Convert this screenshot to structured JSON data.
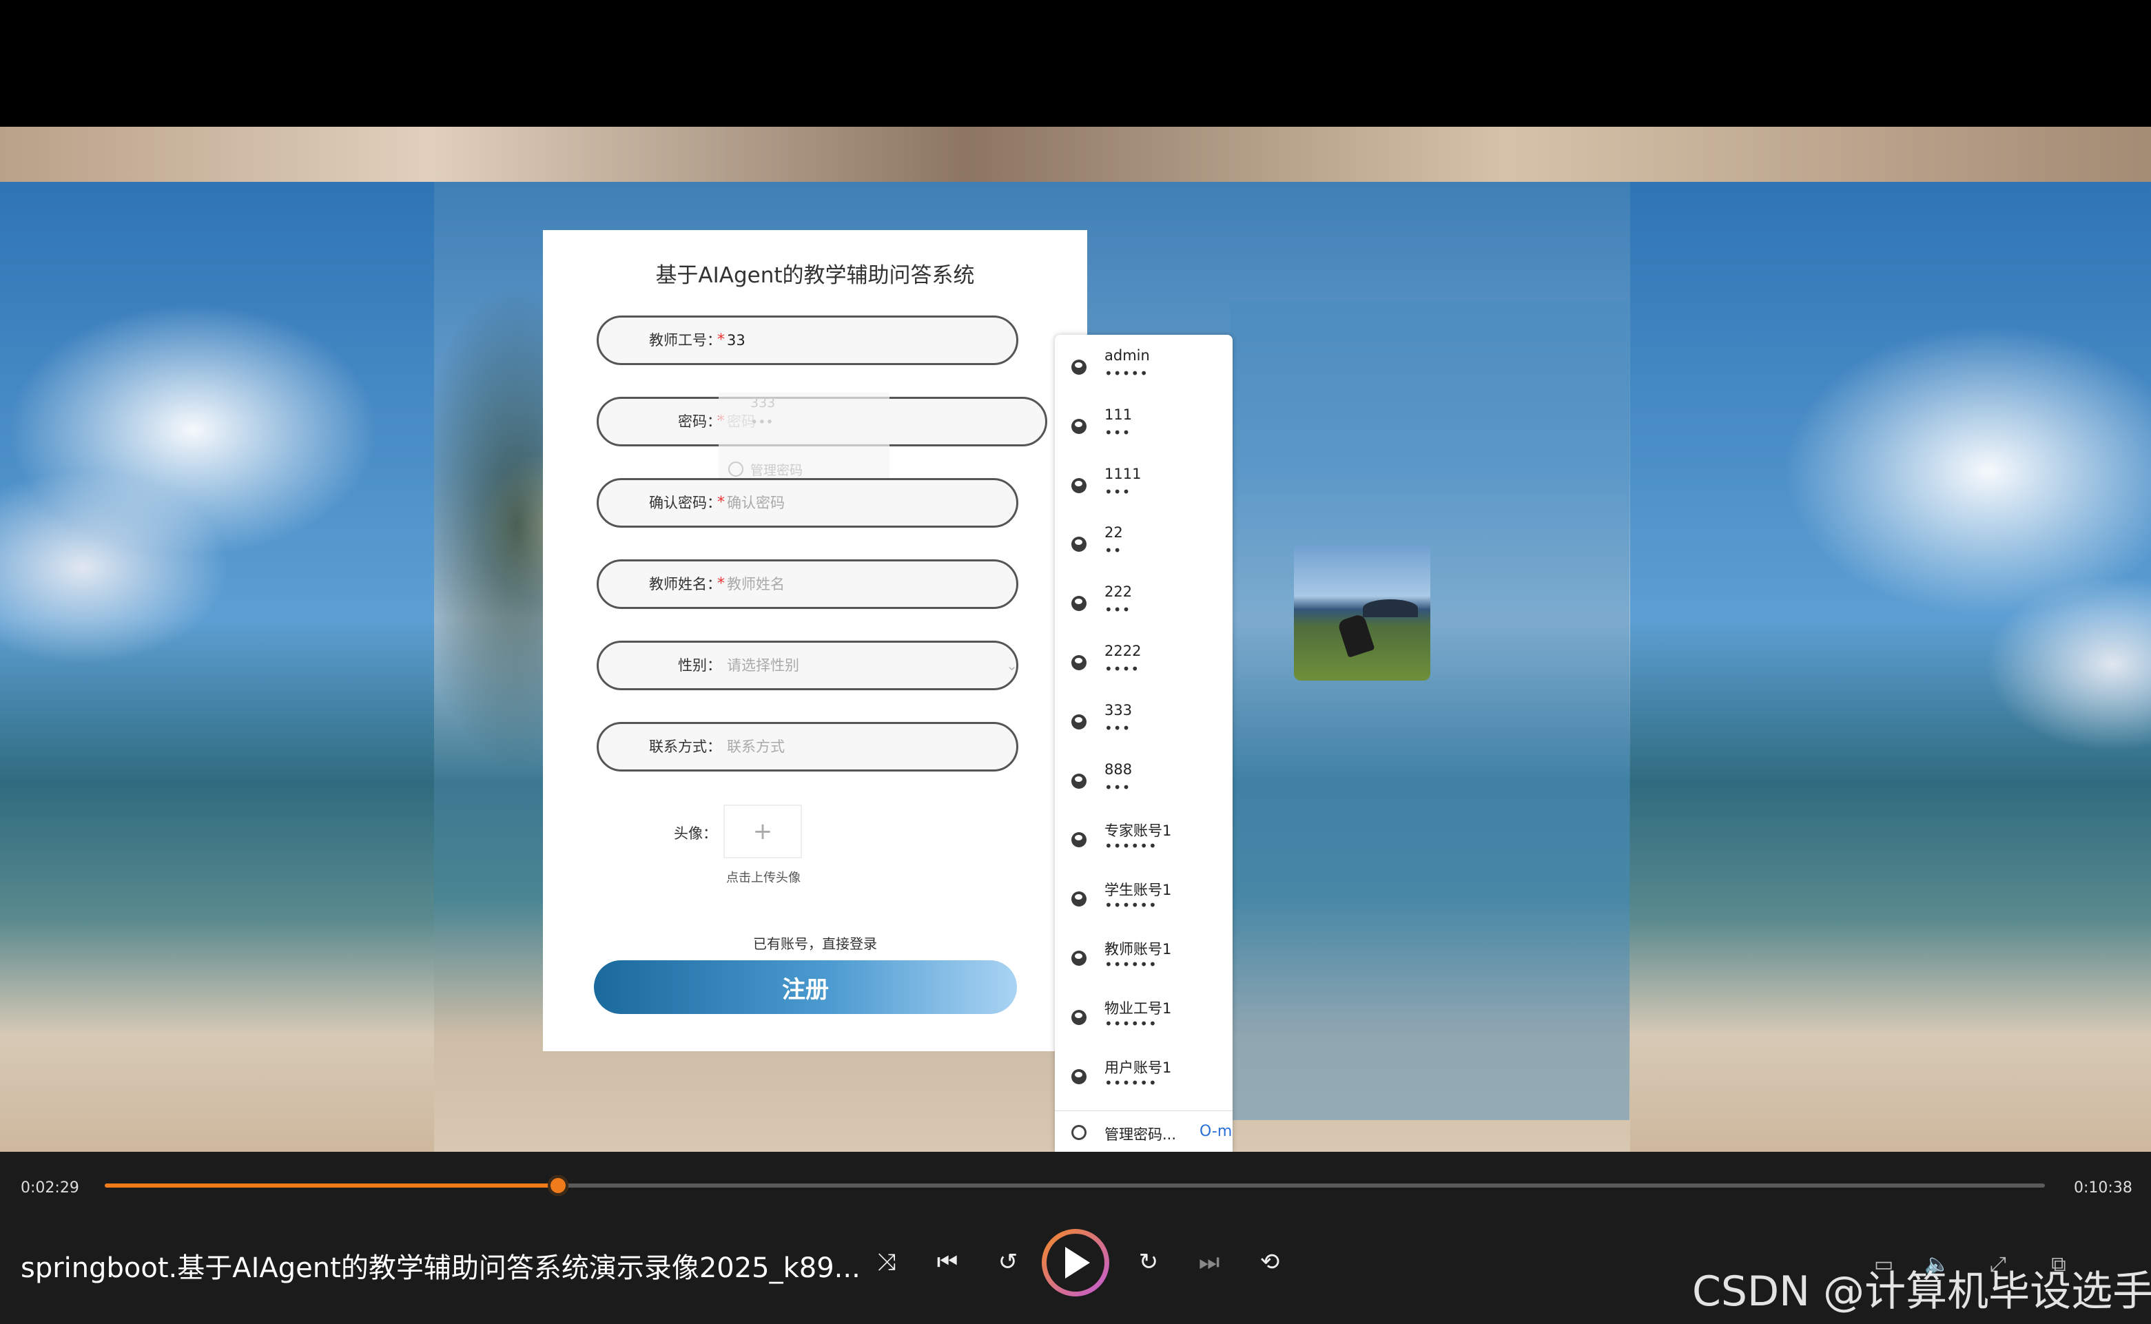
{
  "form": {
    "title": "基于AIAgent的教学辅助问答系统",
    "required_mark": "*",
    "fields": [
      {
        "label": "教师工号：",
        "value": "33",
        "placeholder": ""
      },
      {
        "label": "密码：",
        "value": "",
        "placeholder": "密码"
      },
      {
        "label": "确认密码：",
        "value": "",
        "placeholder": "确认密码"
      },
      {
        "label": "教师姓名：",
        "value": "",
        "placeholder": "教师姓名"
      },
      {
        "label": "性别：",
        "value": "",
        "placeholder": "请选择性别"
      },
      {
        "label": "联系方式：",
        "value": "",
        "placeholder": "联系方式"
      }
    ],
    "avatar_label": "头像：",
    "upload_hint": "点击上传头像",
    "login_link": "已有账号，直接登录",
    "submit_label": "注册",
    "ghost": {
      "user": "333",
      "pass": "•••",
      "manage": "管理密码"
    }
  },
  "password_dropdown": {
    "items": [
      {
        "user": "admin",
        "pass": "•••••"
      },
      {
        "user": "111",
        "pass": "•••"
      },
      {
        "user": "1111",
        "pass": "•••"
      },
      {
        "user": "22",
        "pass": "••"
      },
      {
        "user": "222",
        "pass": "•••"
      },
      {
        "user": "2222",
        "pass": "••••"
      },
      {
        "user": "333",
        "pass": "•••"
      },
      {
        "user": "888",
        "pass": "•••"
      },
      {
        "user": "专家账号1",
        "pass": "••••••"
      },
      {
        "user": "学生账号1",
        "pass": "••••••"
      },
      {
        "user": "教师账号1",
        "pass": "••••••"
      },
      {
        "user": "物业工号1",
        "pass": "••••••"
      },
      {
        "user": "用户账号1",
        "pass": "••••••"
      }
    ],
    "manage_label": "管理密码...",
    "key_icon": "key-icon"
  },
  "player": {
    "current_time": "0:02:29",
    "total_time": "0:10:38",
    "progress": 0.2335,
    "title": "springboot.基于AIAgent的教学辅助问答系统演示录像2025_k89...",
    "accent_color": "#f07b1a"
  },
  "watermark": "CSDN @计算机毕设选手"
}
